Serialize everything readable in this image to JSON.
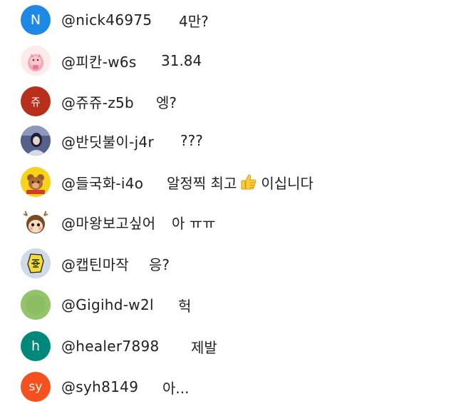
{
  "chat": {
    "messages": [
      {
        "username": "@nick46975",
        "text": "4만?",
        "avatar": {
          "type": "letter",
          "letter": "N",
          "color": "#1e88e5"
        }
      },
      {
        "username": "@피칸-w6s",
        "text": "31.84",
        "avatar": {
          "type": "image",
          "icon": "pink-character-avatar-icon",
          "color": "#fbe3e3"
        }
      },
      {
        "username": "@쥬쥬-z5b",
        "text": "엥?",
        "avatar": {
          "type": "letter",
          "letter": "쥬",
          "color": "#b8301c"
        }
      },
      {
        "username": "@반딧불이-j4r",
        "text": "???",
        "avatar": {
          "type": "image",
          "icon": "portrait-avatar-icon",
          "color": "#3b4463"
        }
      },
      {
        "username": "@들국화-i4o",
        "text": "알정찍 최고",
        "text_after": "이십니다",
        "avatar": {
          "type": "image",
          "icon": "teddy-bear-avatar-icon",
          "color": "#f6d21a"
        }
      },
      {
        "username": "@마왕보고싶어",
        "text": "아 ㅠㅠ",
        "avatar": {
          "type": "image",
          "icon": "cartoon-face-avatar-icon",
          "color": "#fdf3e6"
        }
      },
      {
        "username": "@캡틴마작",
        "text": "응?",
        "avatar": {
          "type": "image",
          "icon": "yellow-sticker-avatar-icon",
          "color": "#c9d3e3"
        }
      },
      {
        "username": "@Gigihd-w2l",
        "text": "헉",
        "avatar": {
          "type": "image",
          "icon": "green-circle-avatar-icon",
          "color": "#93c46a"
        }
      },
      {
        "username": "@healer7898",
        "text": "제발",
        "avatar": {
          "type": "letter",
          "letter": "h",
          "color": "#00897b"
        }
      },
      {
        "username": "@syh8149",
        "text": "아...",
        "avatar": {
          "type": "letter",
          "letter": "sy",
          "color": "#f4511e"
        }
      }
    ],
    "thumbs_up_icon": "thumbs-up-emoji-icon"
  }
}
